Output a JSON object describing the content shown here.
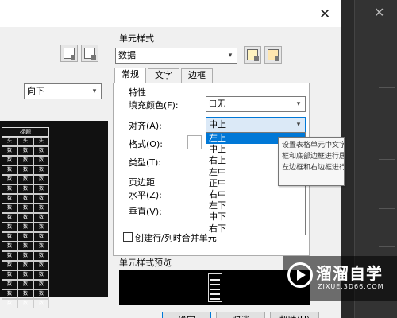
{
  "background": {
    "close_glyph": "✕"
  },
  "dialog": {
    "close_glyph": "✕",
    "direction_combo": {
      "value": "向下",
      "arrow": "▾"
    },
    "table_preview": {
      "caption": "标题",
      "header_row": [
        "头",
        "头",
        "头"
      ],
      "data_row": [
        "数",
        "数",
        "数"
      ],
      "data_row_count": 17
    },
    "cell_style": {
      "group_label": "单元样式",
      "combo_value": "数据",
      "arrow": "▾"
    },
    "tabs": [
      {
        "label": "常规",
        "active": true
      },
      {
        "label": "文字",
        "active": false
      },
      {
        "label": "边框",
        "active": false
      }
    ],
    "general": {
      "properties_label": "特性",
      "fill_color_label": "填充颜色(F):",
      "fill_color_value": "☐无",
      "alignment_label": "对齐(A):",
      "alignment_value": "中上",
      "format_label": "格式(O):",
      "type_label": "类型(T):",
      "margins_label": "页边距",
      "horizontal_label": "水平(Z):",
      "vertical_label": "垂直(V):",
      "merge_checkbox_label": "创建行/列时合并单元",
      "merge_checked": false
    },
    "alignment_options": [
      "左上",
      "中上",
      "右上",
      "左中",
      "正中",
      "右中",
      "左下",
      "中下",
      "右下"
    ],
    "alignment_highlighted": "左上",
    "tooltip": {
      "lines": [
        "设置表格单元中文字的对正和",
        "框和底部边框进行居中对齐、上",
        "左边框和右边框进行居中对正、"
      ]
    },
    "preview_label": "单元样式预览",
    "buttons": {
      "ok": "确定",
      "cancel": "取消",
      "help": "帮助(H)"
    }
  },
  "watermark": {
    "title": "溜溜自学",
    "subtitle": "ZIXUE.3D66.COM"
  },
  "colors": {
    "selection": "#0078d7",
    "dialog_bg": "#f0f0f0",
    "preview_bg": "#000000"
  }
}
